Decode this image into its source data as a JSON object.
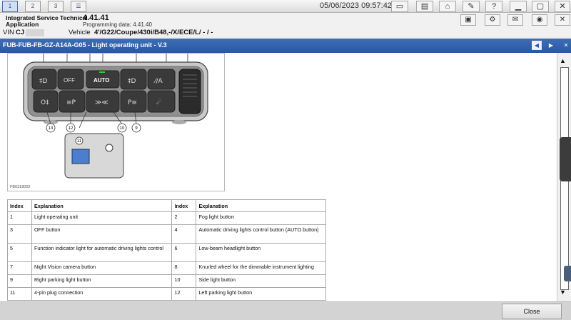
{
  "toolbar": {
    "tabs": [
      "1",
      "2",
      "3"
    ],
    "datetime": "05/06/2023 09:57:42"
  },
  "app": {
    "name_line1": "Integrated Service Technical",
    "name_line2": "Application",
    "version": "4.41.41",
    "programming_data": "Programming data:  4.41.40"
  },
  "vehicle": {
    "vin_label": "VIN",
    "vin_value": "CJ",
    "vehicle_label": "Vehicle",
    "vehicle_value": "4'/G22/Coupe/430i/B48,-/X/ECE/L/ - / -"
  },
  "document": {
    "title": "FUB-FUB-FB-GZ-A14A-G05 - Light operating unit - V.3",
    "figure_id": "FB6318002",
    "figure_labels": {
      "auto": "AUTO",
      "off": "OFF",
      "n13": "13",
      "n12": "12",
      "n10": "10",
      "n9": "9",
      "n11": "11"
    },
    "table": {
      "headers": [
        "Index",
        "Explanation",
        "Index",
        "Explanation"
      ],
      "rows": [
        [
          "1",
          "Light operating unit",
          "2",
          "Fog light button"
        ],
        [
          "3",
          "OFF button",
          "4",
          "Automatic driving lights control button (AUTO button)"
        ],
        [
          "5",
          "Function indicator light for automatic driving lights control",
          "6",
          "Low-beam headlight button"
        ],
        [
          "7",
          "Night Vision camera button",
          "8",
          "Knurled wheel for the dimmable instrument lighting"
        ],
        [
          "9",
          "Right parking light button",
          "10",
          "Side light button"
        ],
        [
          "11",
          "4-pin plug connection",
          "12",
          "Left parking light button"
        ]
      ]
    }
  },
  "footer": {
    "close_label": "Close"
  },
  "colors": {
    "header_blue": "#2f5fae",
    "active_tab": "#cfe0f6"
  }
}
